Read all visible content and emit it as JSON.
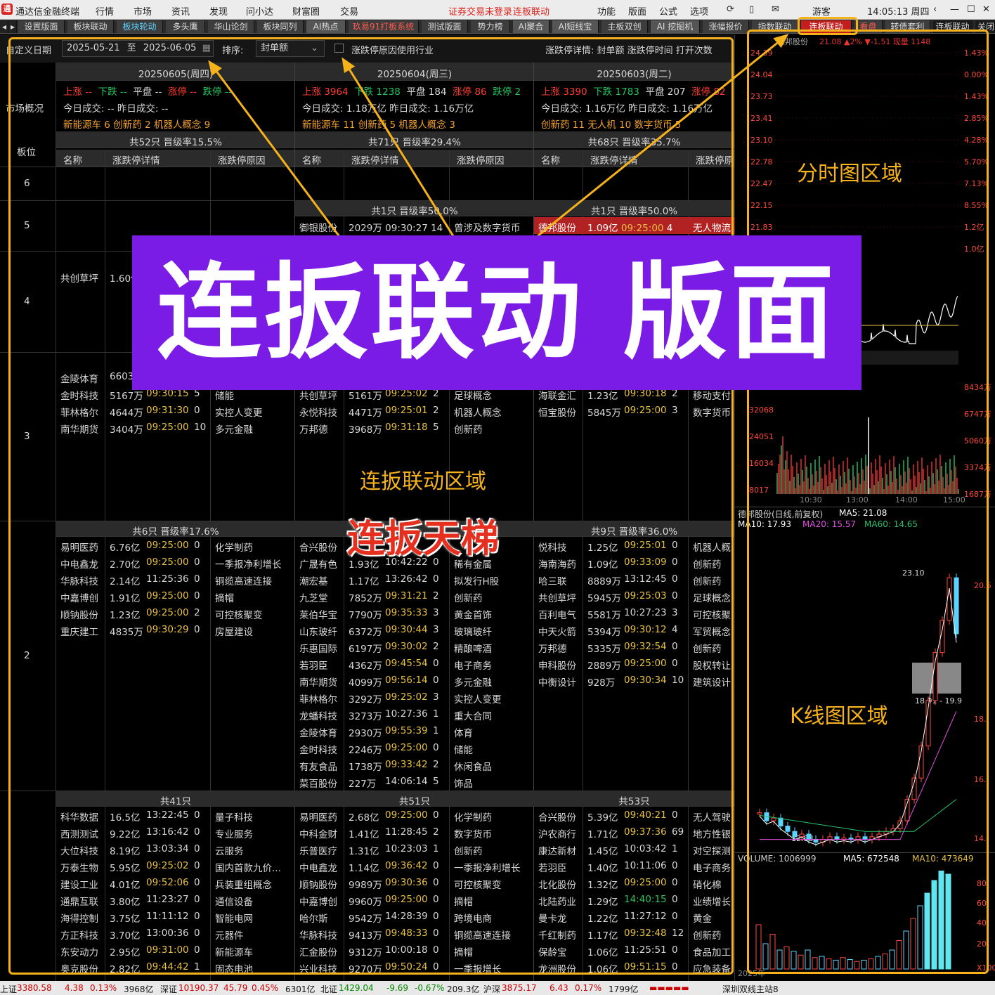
{
  "menubar": {
    "app_title": "通达信金融终端",
    "menus": [
      "行情",
      "市场",
      "资讯",
      "发现",
      "问小达",
      "财富圈",
      "交易"
    ],
    "login_status": "证券交易未登录",
    "current_layout": "连板联动",
    "right_menus": [
      "功能",
      "版面",
      "公式",
      "选项"
    ],
    "user": "游客",
    "clock": "14:05:13 周四"
  },
  "tabs": [
    "设置版面",
    "板块联动",
    "板块轮动",
    "多头鹰",
    "华山论剑",
    "板块同列",
    "AI热点",
    "玖易91打板系统",
    "测试版面",
    "势力榜",
    "AI聚合",
    "AI短线宝",
    "主板双创",
    "AI 挖掘机",
    "涨幅报价",
    "指数联动",
    "连板联动",
    "看盘",
    "转债套利",
    "连板联动",
    "关闭"
  ],
  "filter": {
    "custom_date_label": "自定义日期",
    "date_from": "2025-05-21",
    "to_label": "至",
    "date_to": "2025-06-05",
    "sort_label": "排序:",
    "sort_value": "封单额",
    "checkbox_label": "涨跌停原因使用行业",
    "detail_label": "涨跌停详情: 封单额 涨跌停时间 打开次数"
  },
  "labels": {
    "market_overview": "市场概况",
    "board_level": "板位",
    "col_name": "名称",
    "col_detail": "涨跌停详情",
    "col_reason": "涨跌停原因",
    "col_reason_short": "涨跌停原"
  },
  "days": [
    {
      "date": "20250605(周四)",
      "up": "上涨 --",
      "down": "下跌 --",
      "flat": "平盘 --",
      "limit_up": "涨停 --",
      "limit_down": "跌停 --",
      "turnover": "今日成交: --  昨日成交: --",
      "hot": "新能源车 6  创新药 2  机器人概念 9",
      "summary": "共52只 晋级率15.5%"
    },
    {
      "date": "20250604(周三)",
      "up": "上涨 3964",
      "down": "下跌 1238",
      "flat": "平盘 184",
      "limit_up": "涨停 86",
      "limit_down": "跌停 2",
      "turnover": "今日成交: 1.18万亿  昨日成交: 1.16万亿",
      "hot": "新能源车 11  创新药 5  机器人概念 3",
      "summary": "共71只 晋级率29.4%"
    },
    {
      "date": "20250603(周二)",
      "up": "上涨 3390",
      "down": "下跌 1783",
      "flat": "平盘 207",
      "limit_up": "涨停 82",
      "limit_down": "",
      "turnover": "今日成交: 1.16万亿  昨日成交: 1.16万亿",
      "hot": "创新药 11  无人机 10  数字货币 5",
      "summary": "共68只 晋级率35.7%"
    }
  ],
  "levels": [
    "6",
    "5",
    "4",
    "3",
    "2"
  ],
  "level5": {
    "col2_header": "共1只 晋级率50.0%",
    "col3_header": "共1只 晋级率50.0%",
    "col2_row": {
      "name": "御银股份",
      "amount": "2029万",
      "time": "09:30:27",
      "opens": "14",
      "reason": "曾涉及数字货币"
    },
    "col3_row": {
      "name": "德邦股份",
      "amount": "1.09亿",
      "time": "09:25:00",
      "opens": "4",
      "reason": "无人物流"
    }
  },
  "level4": {
    "col1_row": {
      "name": "共创草坪",
      "amount": "1.60亿"
    }
  },
  "level3": {
    "col1": [
      {
        "name": "金陵体育",
        "amount": "6603",
        "time": "",
        "opens": "",
        "reason": ""
      },
      {
        "name": "金时科技",
        "amount": "5167万",
        "time": "09:30:15",
        "opens": "5",
        "reason": "储能"
      },
      {
        "name": "菲林格尔",
        "amount": "4644万",
        "time": "09:31:30",
        "opens": "0",
        "reason": "实控人变更"
      },
      {
        "name": "南华期货",
        "amount": "3404万",
        "time": "09:25:00",
        "opens": "10",
        "reason": "多元金融"
      }
    ],
    "col2": [
      {
        "name": "共创草坪",
        "amount": "5161万",
        "time": "09:25:02",
        "opens": "2",
        "reason": "足球概念"
      },
      {
        "name": "永悦科技",
        "amount": "4471万",
        "time": "09:25:01",
        "opens": "2",
        "reason": "机器人概念"
      },
      {
        "name": "万邦德",
        "amount": "3968万",
        "time": "09:31:18",
        "opens": "5",
        "reason": "创新药"
      }
    ],
    "col3": [
      {
        "name": "海联金汇",
        "amount": "1.23亿",
        "time": "09:30:18",
        "opens": "2",
        "reason": "移动支付"
      },
      {
        "name": "恒宝股份",
        "amount": "5845万",
        "time": "09:25:00",
        "opens": "3",
        "reason": "数字货币"
      }
    ]
  },
  "level2": {
    "col1_header": "共6只 晋级率17.6%",
    "col3_header": "共9只 晋级率36.0%",
    "col1": [
      {
        "name": "易明医药",
        "amount": "6.76亿",
        "time": "09:25:00",
        "opens": "0",
        "reason": "化学制药"
      },
      {
        "name": "中电鑫龙",
        "amount": "2.70亿",
        "time": "09:25:00",
        "opens": "0",
        "reason": "一季报净利增长"
      },
      {
        "name": "华脉科技",
        "amount": "2.14亿",
        "time": "11:25:36",
        "opens": "0",
        "reason": "铜缆高速连接"
      },
      {
        "name": "中嘉博创",
        "amount": "1.91亿",
        "time": "09:25:00",
        "opens": "0",
        "reason": "摘帽"
      },
      {
        "name": "顺钠股份",
        "amount": "1.23亿",
        "time": "09:25:00",
        "opens": "2",
        "reason": "可控核聚变"
      },
      {
        "name": "重庆建工",
        "amount": "4835万",
        "time": "09:30:29",
        "opens": "0",
        "reason": "房屋建设"
      }
    ],
    "col2": [
      {
        "name": "合兴股份",
        "amount": "",
        "time": "",
        "opens": "",
        "reason": ""
      },
      {
        "name": "广晟有色",
        "amount": "1.93亿",
        "time": "10:42:22",
        "opens": "0",
        "reason": "稀有金属"
      },
      {
        "name": "潮宏基",
        "amount": "1.17亿",
        "time": "13:26:42",
        "opens": "0",
        "reason": "拟发行H股"
      },
      {
        "name": "九芝堂",
        "amount": "7852万",
        "time": "09:31:21",
        "opens": "2",
        "reason": "创新药"
      },
      {
        "name": "莱伯华宝",
        "amount": "7790万",
        "time": "09:35:33",
        "opens": "3",
        "reason": "黄金首饰"
      },
      {
        "name": "山东玻纤",
        "amount": "6372万",
        "time": "09:30:44",
        "opens": "3",
        "reason": "玻璃玻纤"
      },
      {
        "name": "乐惠国际",
        "amount": "6197万",
        "time": "09:30:02",
        "opens": "2",
        "reason": "精酿啤酒"
      },
      {
        "name": "若羽臣",
        "amount": "4362万",
        "time": "09:45:54",
        "opens": "0",
        "reason": "电子商务"
      },
      {
        "name": "南华期货",
        "amount": "4099万",
        "time": "09:56:14",
        "opens": "0",
        "reason": "多元金融"
      },
      {
        "name": "菲林格尔",
        "amount": "3292万",
        "time": "09:25:02",
        "opens": "3",
        "reason": "实控人变更"
      },
      {
        "name": "龙蟠科技",
        "amount": "3273万",
        "time": "10:27:36",
        "opens": "1",
        "reason": "重大合同"
      },
      {
        "name": "金陵体育",
        "amount": "2930万",
        "time": "09:55:39",
        "opens": "1",
        "reason": "体育"
      },
      {
        "name": "金时科技",
        "amount": "2246万",
        "time": "09:25:00",
        "opens": "0",
        "reason": "储能"
      },
      {
        "name": "有友食品",
        "amount": "1738万",
        "time": "09:33:42",
        "opens": "2",
        "reason": "休闲食品"
      },
      {
        "name": "菜百股份",
        "amount": "227万",
        "time": "14:06:14",
        "opens": "5",
        "reason": "饰品"
      }
    ],
    "col3": [
      {
        "name": "悦科技",
        "amount": "1.25亿",
        "time": "09:25:01",
        "opens": "0",
        "reason": "机器人概"
      },
      {
        "name": "海南海药",
        "amount": "1.09亿",
        "time": "09:33:09",
        "opens": "0",
        "reason": "创新药"
      },
      {
        "name": "哈三联",
        "amount": "8889万",
        "time": "13:12:45",
        "opens": "0",
        "reason": "创新药"
      },
      {
        "name": "共创草坪",
        "amount": "5945万",
        "time": "09:25:03",
        "opens": "0",
        "reason": "足球概念"
      },
      {
        "name": "百利电气",
        "amount": "5581万",
        "time": "10:27:23",
        "opens": "3",
        "reason": "可控核聚"
      },
      {
        "name": "中天火箭",
        "amount": "5394万",
        "time": "09:30:12",
        "opens": "4",
        "reason": "军贸概念"
      },
      {
        "name": "万邦德",
        "amount": "5335万",
        "time": "09:32:54",
        "opens": "0",
        "reason": "创新药"
      },
      {
        "name": "申科股份",
        "amount": "2889万",
        "time": "09:25:00",
        "opens": "0",
        "reason": "股权转让"
      },
      {
        "name": "中衡设计",
        "amount": "928万",
        "time": "09:30:34",
        "opens": "10",
        "reason": "建筑设计"
      }
    ]
  },
  "level1": {
    "headers": [
      "共41只",
      "共51只",
      "共53只"
    ],
    "col1": [
      {
        "name": "科华数据",
        "amount": "16.5亿",
        "time": "13:22:45",
        "opens": "0",
        "reason": "量子科技"
      },
      {
        "name": "西测测试",
        "amount": "9.22亿",
        "time": "13:16:42",
        "opens": "0",
        "reason": "专业服务"
      },
      {
        "name": "大位科技",
        "amount": "8.19亿",
        "time": "13:03:34",
        "opens": "0",
        "reason": "云服务"
      },
      {
        "name": "万泰生物",
        "amount": "5.95亿",
        "time": "09:25:02",
        "opens": "0",
        "reason": "国内首款九价..."
      },
      {
        "name": "建设工业",
        "amount": "4.01亿",
        "time": "09:52:06",
        "opens": "0",
        "reason": "兵装重组概念"
      },
      {
        "name": "通鼎互联",
        "amount": "3.80亿",
        "time": "11:23:27",
        "opens": "0",
        "reason": "通信设备"
      },
      {
        "name": "海得控制",
        "amount": "3.75亿",
        "time": "11:11:12",
        "opens": "0",
        "reason": "智能电网"
      },
      {
        "name": "方正科技",
        "amount": "3.70亿",
        "time": "13:00:36",
        "opens": "0",
        "reason": "元器件"
      },
      {
        "name": "东安动力",
        "amount": "2.95亿",
        "time": "09:31:00",
        "opens": "0",
        "reason": "新能源车"
      },
      {
        "name": "奥克股份",
        "amount": "2.82亿",
        "time": "09:44:42",
        "opens": "1",
        "reason": "固态电池"
      }
    ],
    "col2": [
      {
        "name": "易明医药",
        "amount": "2.68亿",
        "time": "09:25:00",
        "opens": "0",
        "reason": "化学制药"
      },
      {
        "name": "中科金财",
        "amount": "1.41亿",
        "time": "11:28:45",
        "opens": "2",
        "reason": "数字货币"
      },
      {
        "name": "乐普医疗",
        "amount": "1.31亿",
        "time": "10:23:03",
        "opens": "1",
        "reason": "创新药"
      },
      {
        "name": "中电鑫龙",
        "amount": "1.14亿",
        "time": "09:36:42",
        "opens": "0",
        "reason": "一季报净利增长"
      },
      {
        "name": "顺钠股份",
        "amount": "9989万",
        "time": "09:30:36",
        "opens": "0",
        "reason": "可控核聚变"
      },
      {
        "name": "中嘉博创",
        "amount": "9960万",
        "time": "09:25:00",
        "opens": "0",
        "reason": "摘帽"
      },
      {
        "name": "哈尔斯",
        "amount": "9542万",
        "time": "14:28:39",
        "opens": "0",
        "reason": "跨境电商"
      },
      {
        "name": "华脉科技",
        "amount": "9413万",
        "time": "09:48:33",
        "opens": "0",
        "reason": "铜缆高速连接"
      },
      {
        "name": "汇金股份",
        "amount": "9312万",
        "time": "10:00:18",
        "opens": "0",
        "reason": "摘帽"
      },
      {
        "name": "兴业科技",
        "amount": "9270万",
        "time": "09:50:24",
        "opens": "0",
        "reason": "一季报增长"
      }
    ],
    "col3": [
      {
        "name": "合兴股份",
        "amount": "5.39亿",
        "time": "09:40:21",
        "opens": "0",
        "reason": "无人驾驶"
      },
      {
        "name": "沪农商行",
        "amount": "1.71亿",
        "time": "09:37:36",
        "opens": "69",
        "reason": "地方性银"
      },
      {
        "name": "康达新材",
        "amount": "1.45亿",
        "time": "10:03:42",
        "opens": "1",
        "reason": "对空探测"
      },
      {
        "name": "若羽臣",
        "amount": "1.40亿",
        "time": "10:11:06",
        "opens": "0",
        "reason": "电子商务"
      },
      {
        "name": "北化股份",
        "amount": "1.32亿",
        "time": "09:25:00",
        "opens": "0",
        "reason": "硝化棉"
      },
      {
        "name": "北陆药业",
        "amount": "1.29亿",
        "time": "14:40:15",
        "opens": "0",
        "reason": "业绩增长"
      },
      {
        "name": "曼卡龙",
        "amount": "1.22亿",
        "time": "11:27:12",
        "opens": "0",
        "reason": "黄金"
      },
      {
        "name": "千红制药",
        "amount": "1.17亿",
        "time": "09:32:48",
        "opens": "12",
        "reason": "创新药"
      },
      {
        "name": "保龄宝",
        "amount": "1.06亿",
        "time": "11:25:51",
        "opens": "0",
        "reason": "食品加工"
      },
      {
        "name": "龙洲股份",
        "amount": "1.06亿",
        "time": "09:51:15",
        "opens": "0",
        "reason": "应急装备"
      }
    ]
  },
  "right_panel": {
    "intraday_title": "德邦股份",
    "intraday_stats": "21.08  ▲2%  ▼-1.51  现量 1148",
    "intraday_prices": [
      "24.39",
      "24.04",
      "23.73",
      "23.41",
      "23.10",
      "22.78",
      "22.47",
      "22.15",
      "21.83"
    ],
    "intraday_pct": [
      "1.43%",
      "0.00%",
      "1.43%",
      "2.85%",
      "4.28%",
      "5.70%",
      "7.13%",
      "8.55%",
      "1.2亿",
      "1.0亿"
    ],
    "intraday_vol": [
      "8434万",
      "6747万",
      "5060万",
      "3374万",
      "1687万"
    ],
    "intraday_vol_left": [
      "32068",
      "24051",
      "16034",
      "8017"
    ],
    "intraday_times": [
      "10:30",
      "13:00",
      "14:00",
      "15:00"
    ],
    "kline_title": "德邦股份(日线,前复权)",
    "ma5": "MA5: 21.08",
    "ma10": "MA10: 17.93",
    "ma20": "MA20: 15.57",
    "ma60": "MA60: 14.65",
    "kline_high": "23.10",
    "kline_range": "18.91 - 19.9",
    "kline_low": "12.88",
    "kline_axis": [
      "20.6",
      "18.",
      "16.",
      "14."
    ],
    "volume_title": "VOLUME: 1006999",
    "vol_ma5": "MA5: 672548",
    "vol_ma10": "MA10: 473649",
    "year_label": "2025年",
    "vol_axis": [
      "80",
      "60",
      "40",
      "20",
      "X100"
    ]
  },
  "overlays": {
    "banner": "连扳联动 版面",
    "intraday_area": "分时图区域",
    "kline_area": "K线图区域",
    "linkage_area": "连扳联动区域",
    "ladder": "连扳天梯"
  },
  "statusbar": {
    "sh_label": "上证",
    "sh_val": "3380.58",
    "sh_chg": "4.38",
    "sh_pct": "0.13%",
    "sh_amt": "3968亿",
    "sz_label": "深证",
    "sz_val": "10190.37",
    "sz_chg": "45.79",
    "sz_pct": "0.45%",
    "sz_amt": "6301亿",
    "bz_label": "北证",
    "bz_val": "1429.04",
    "bz_chg": "-9.69",
    "bz_pct": "-0.67%",
    "bz_amt": "209.3亿",
    "hs_label": "沪深",
    "hs_val": "3875.17",
    "hs_chg": "6.43",
    "hs_pct": "0.17%",
    "hs_amt": "1799亿",
    "server": "深圳双线主站8"
  },
  "colors": {
    "accent_frame": "#f5b21b",
    "banner": "#7b1be6",
    "up": "#ff3b30",
    "down": "#22c55e"
  }
}
